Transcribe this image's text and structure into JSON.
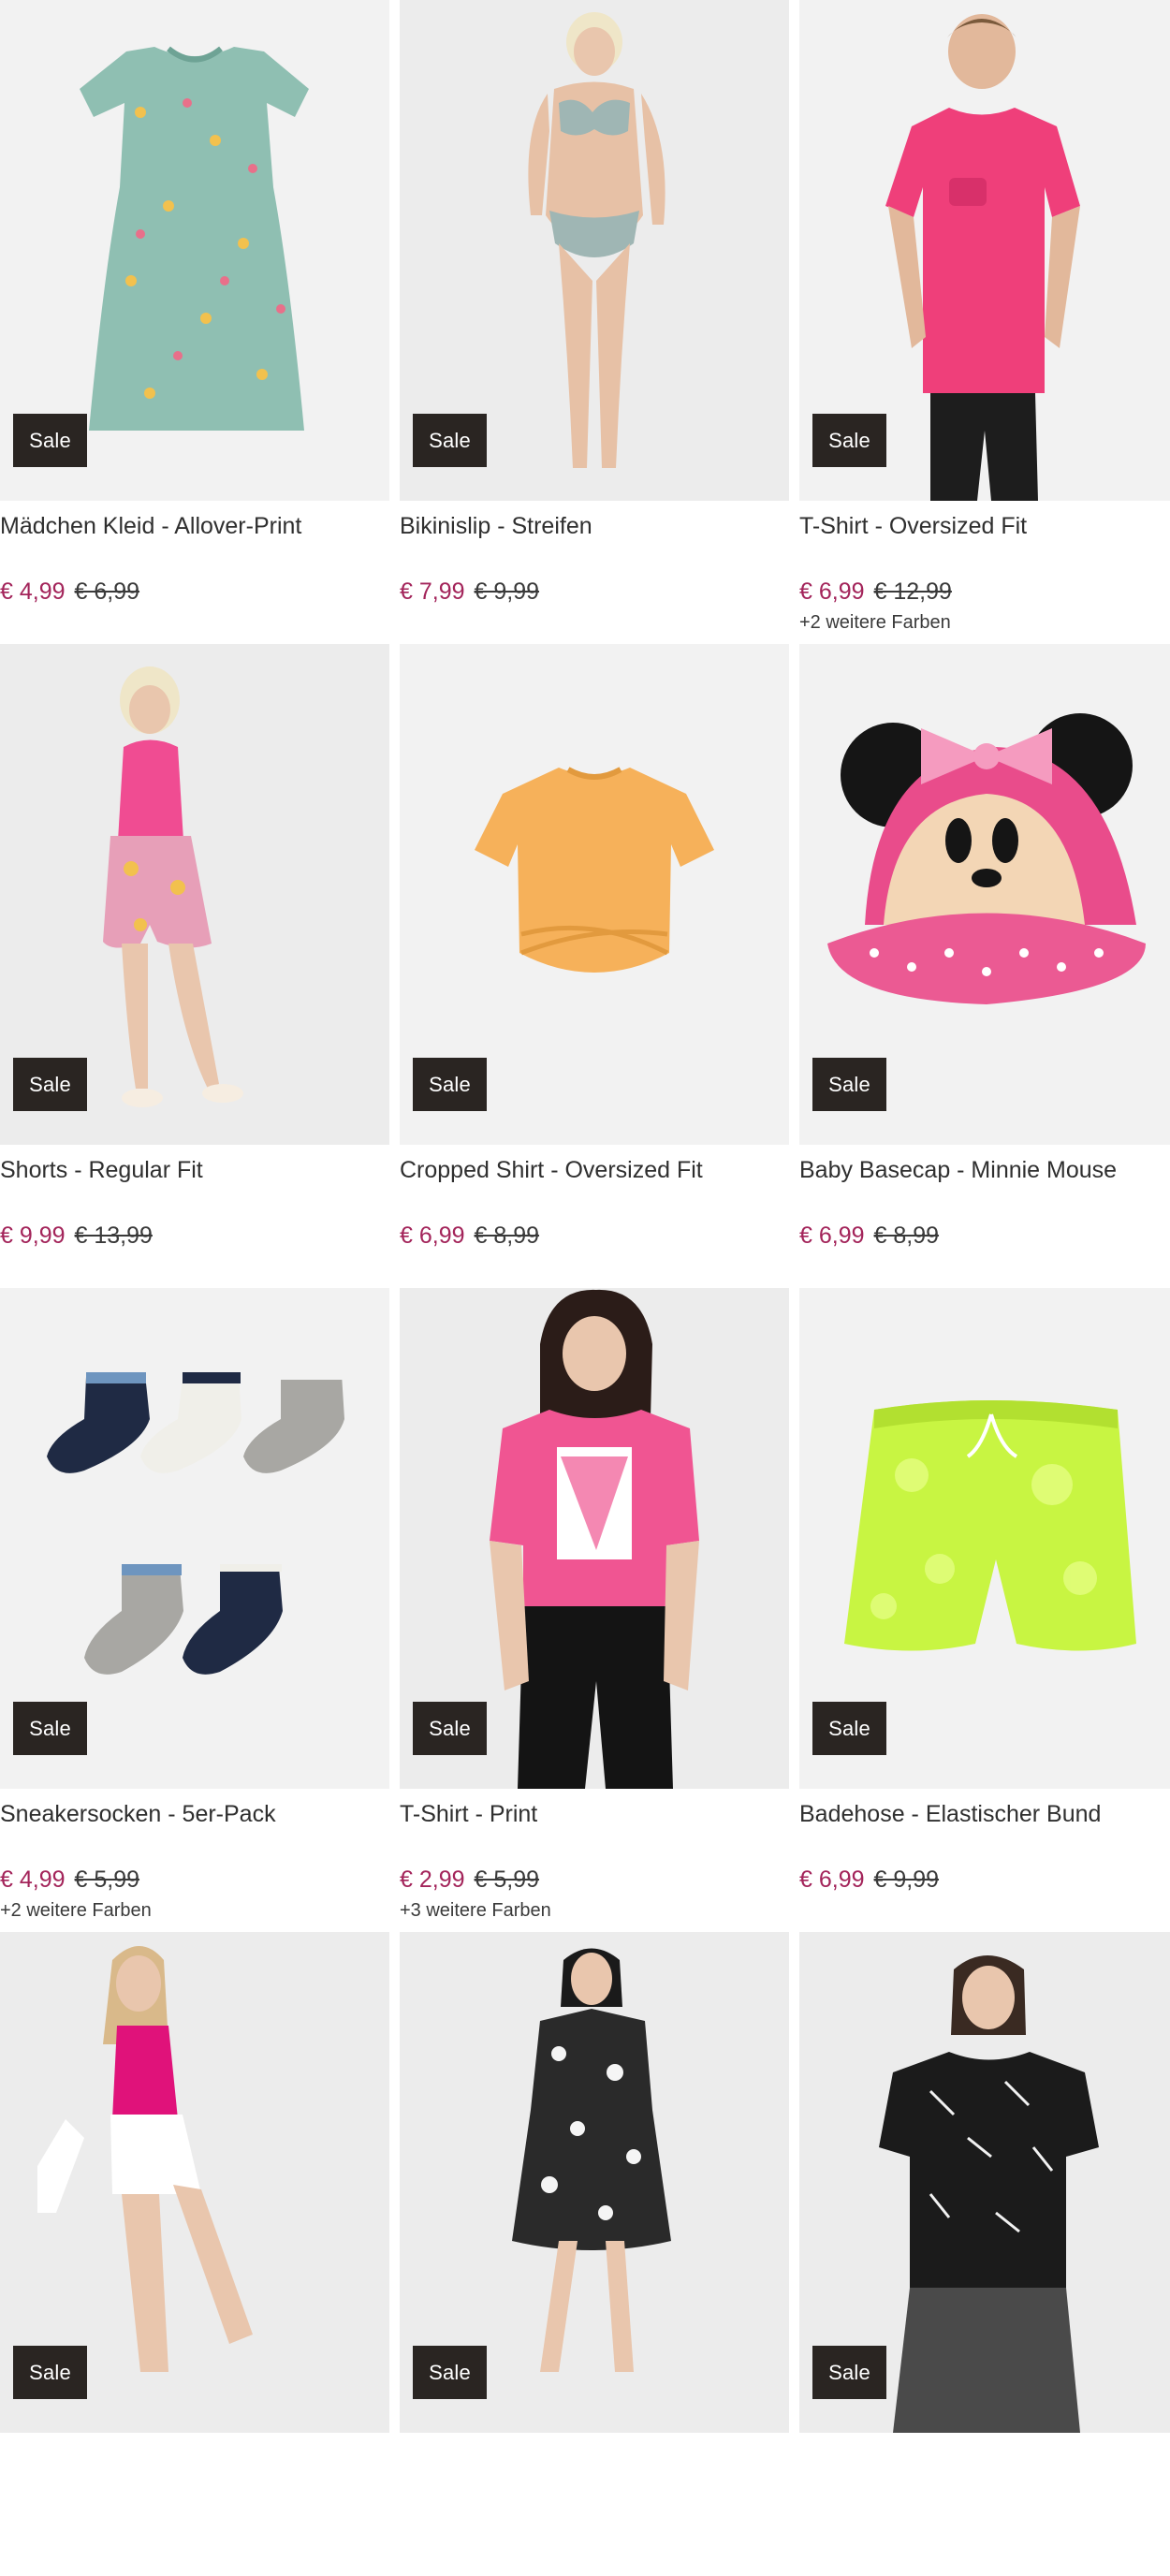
{
  "colors": {
    "sale_badge_bg": "#2a2522",
    "price_now": "#a3245a",
    "price_old": "#3a3a3a"
  },
  "products": [
    {
      "title": "Mädchen Kleid - Allover-Print",
      "badge": "Sale",
      "price_now": "€ 4,99",
      "price_old": "€ 6,99",
      "more_colors": "",
      "image": "mint-dress"
    },
    {
      "title": "Bikinislip - Streifen",
      "badge": "Sale",
      "price_now": "€ 7,99",
      "price_old": "€ 9,99",
      "more_colors": "",
      "image": "bikini-model"
    },
    {
      "title": "T-Shirt - Oversized Fit",
      "badge": "Sale",
      "price_now": "€ 6,99",
      "price_old": "€ 12,99",
      "more_colors": "+2 weitere Farben",
      "image": "pink-tshirt-model"
    },
    {
      "title": "Shorts - Regular Fit",
      "badge": "Sale",
      "price_now": "€ 9,99",
      "price_old": "€ 13,99",
      "more_colors": "",
      "image": "shorts-model"
    },
    {
      "title": "Cropped Shirt - Oversized Fit",
      "badge": "Sale",
      "price_now": "€ 6,99",
      "price_old": "€ 8,99",
      "more_colors": "",
      "image": "yellow-cropped-shirt"
    },
    {
      "title": "Baby Basecap - Minnie Mouse",
      "badge": "Sale",
      "price_now": "€ 6,99",
      "price_old": "€ 8,99",
      "more_colors": "",
      "image": "minnie-cap"
    },
    {
      "title": "Sneakersocken - 5er-Pack",
      "badge": "Sale",
      "price_now": "€ 4,99",
      "price_old": "€ 5,99",
      "more_colors": "+2 weitere Farben",
      "image": "socks-pack"
    },
    {
      "title": "T-Shirt - Print",
      "badge": "Sale",
      "price_now": "€ 2,99",
      "price_old": "€ 5,99",
      "more_colors": "+3 weitere Farben",
      "image": "pink-print-tshirt-model"
    },
    {
      "title": "Badehose - Elastischer Bund",
      "badge": "Sale",
      "price_now": "€ 6,99",
      "price_old": "€ 9,99",
      "more_colors": "",
      "image": "neon-swim-shorts"
    },
    {
      "title": "",
      "badge": "Sale",
      "price_now": "",
      "price_old": "",
      "more_colors": "",
      "image": "pink-top-model"
    },
    {
      "title": "",
      "badge": "Sale",
      "price_now": "",
      "price_old": "",
      "more_colors": "",
      "image": "floral-dress-model"
    },
    {
      "title": "",
      "badge": "Sale",
      "price_now": "",
      "price_old": "",
      "more_colors": "",
      "image": "black-print-shirt-model"
    }
  ]
}
